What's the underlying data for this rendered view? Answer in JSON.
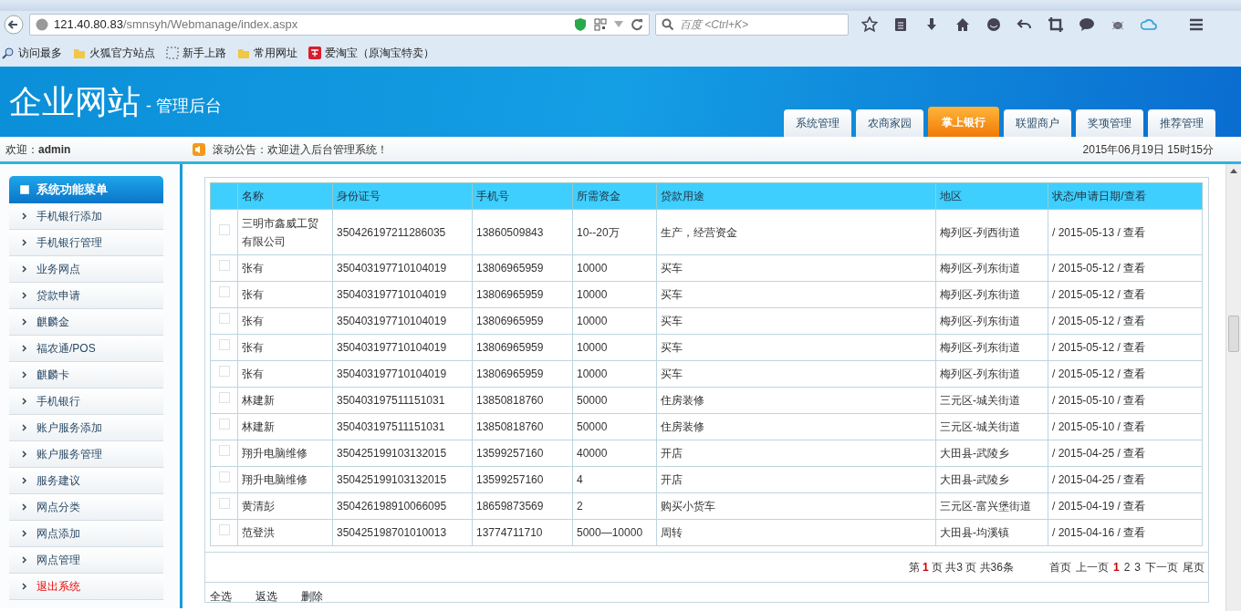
{
  "browser": {
    "url_host": "121.40.80.83",
    "url_path": "/smnsyh/Webmanage/index.aspx",
    "search_placeholder": "百度 <Ctrl+K>",
    "bookmarks": [
      {
        "label": "访问最多",
        "kind": "search"
      },
      {
        "label": "火狐官方站点",
        "kind": "folder"
      },
      {
        "label": "新手上路",
        "kind": "dashed"
      },
      {
        "label": "常用网址",
        "kind": "folder"
      },
      {
        "label": "爱淘宝（原淘宝特卖）",
        "kind": "taobao"
      }
    ]
  },
  "header": {
    "title": "企业网站",
    "subtitle": "- 管理后台",
    "tabs": [
      {
        "label": "系统管理",
        "selected": false
      },
      {
        "label": "农商家园",
        "selected": false
      },
      {
        "label": "掌上银行",
        "selected": true
      },
      {
        "label": "联盟商户",
        "selected": false
      },
      {
        "label": "奖项管理",
        "selected": false
      },
      {
        "label": "推荐管理",
        "selected": false
      }
    ]
  },
  "infobar": {
    "welcome": "欢迎：",
    "user": "admin",
    "notice": "滚动公告：欢迎进入后台管理系统！",
    "datetime": "2015年06月19日 15时15分"
  },
  "sidebar": {
    "title": "系统功能菜单",
    "items": [
      {
        "label": "手机银行添加",
        "kind": "normal"
      },
      {
        "label": "手机银行管理",
        "kind": "normal"
      },
      {
        "label": "业务网点",
        "kind": "normal"
      },
      {
        "label": "贷款申请",
        "kind": "normal"
      },
      {
        "label": "麒麟金",
        "kind": "normal"
      },
      {
        "label": "福农通/POS",
        "kind": "normal"
      },
      {
        "label": "麒麟卡",
        "kind": "normal"
      },
      {
        "label": "手机银行",
        "kind": "normal"
      },
      {
        "label": "账户服务添加",
        "kind": "normal"
      },
      {
        "label": "账户服务管理",
        "kind": "normal"
      },
      {
        "label": "服务建议",
        "kind": "normal"
      },
      {
        "label": "网点分类",
        "kind": "normal"
      },
      {
        "label": "网点添加",
        "kind": "normal"
      },
      {
        "label": "网点管理",
        "kind": "normal"
      },
      {
        "label": "退出系统",
        "kind": "exit"
      }
    ]
  },
  "table": {
    "columns": [
      "名称",
      "身份证号",
      "手机号",
      "所需资金",
      "贷款用途",
      "地区",
      "状态/申请日期/查看"
    ],
    "rows": [
      {
        "checked": false,
        "cells": [
          "三明市鑫威工贸有限公司",
          "350426197211286035",
          "13860509843",
          "10--20万",
          "生产，经营资金",
          "梅列区-列西街道",
          "/ 2015-05-13 /"
        ],
        "link": "查看"
      },
      {
        "checked": false,
        "cells": [
          "张有",
          "350403197710104019",
          "13806965959",
          "10000",
          "买车",
          "梅列区-列东街道",
          "/ 2015-05-12 /"
        ],
        "link": "查看"
      },
      {
        "checked": false,
        "cells": [
          "张有",
          "350403197710104019",
          "13806965959",
          "10000",
          "买车",
          "梅列区-列东街道",
          "/ 2015-05-12 /"
        ],
        "link": "查看"
      },
      {
        "checked": false,
        "cells": [
          "张有",
          "350403197710104019",
          "13806965959",
          "10000",
          "买车",
          "梅列区-列东街道",
          "/ 2015-05-12 /"
        ],
        "link": "查看"
      },
      {
        "checked": false,
        "cells": [
          "张有",
          "350403197710104019",
          "13806965959",
          "10000",
          "买车",
          "梅列区-列东街道",
          "/ 2015-05-12 /"
        ],
        "link": "查看"
      },
      {
        "checked": false,
        "cells": [
          "张有",
          "350403197710104019",
          "13806965959",
          "10000",
          "买车",
          "梅列区-列东街道",
          "/ 2015-05-12 /"
        ],
        "link": "查看"
      },
      {
        "checked": false,
        "cells": [
          "林建新",
          "350403197511151031",
          "13850818760",
          "50000",
          "住房装修",
          "三元区-城关街道",
          "/ 2015-05-10 /"
        ],
        "link": "查看"
      },
      {
        "checked": false,
        "cells": [
          "林建新",
          "350403197511151031",
          "13850818760",
          "50000",
          "住房装修",
          "三元区-城关街道",
          "/ 2015-05-10 /"
        ],
        "link": "查看"
      },
      {
        "checked": false,
        "cells": [
          "翔升电脑维修",
          "350425199103132015",
          "13599257160",
          "40000",
          "开店",
          "大田县-武陵乡",
          "/ 2015-04-25 /"
        ],
        "link": "查看"
      },
      {
        "checked": false,
        "cells": [
          "翔升电脑维修",
          "350425199103132015",
          "13599257160",
          "4",
          "开店",
          "大田县-武陵乡",
          "/ 2015-04-25 /"
        ],
        "link": "查看"
      },
      {
        "checked": false,
        "cells": [
          "黄清彭",
          "350426198910066095",
          "18659873569",
          "2",
          "购买小货车",
          "三元区-富兴堡街道",
          "/ 2015-04-19 /"
        ],
        "link": "查看"
      },
      {
        "checked": false,
        "cells": [
          "范登洪",
          "350425198701010013",
          "13774711710",
          "5000—10000",
          "周转",
          "大田县-均溪镇",
          "/ 2015-04-16 /"
        ],
        "link": "查看"
      }
    ]
  },
  "pager": {
    "prefix": "第",
    "current": "1",
    "suffix": "页 共3 页 共36条",
    "links": [
      {
        "label": "首页",
        "selected": false
      },
      {
        "label": "上一页",
        "selected": false
      },
      {
        "label": "1",
        "selected": true
      },
      {
        "label": "2",
        "selected": false
      },
      {
        "label": "3",
        "selected": false
      },
      {
        "label": "下一页",
        "selected": false
      },
      {
        "label": "尾页",
        "selected": false
      }
    ]
  },
  "actions": [
    "全选",
    "返选",
    "删除"
  ]
}
